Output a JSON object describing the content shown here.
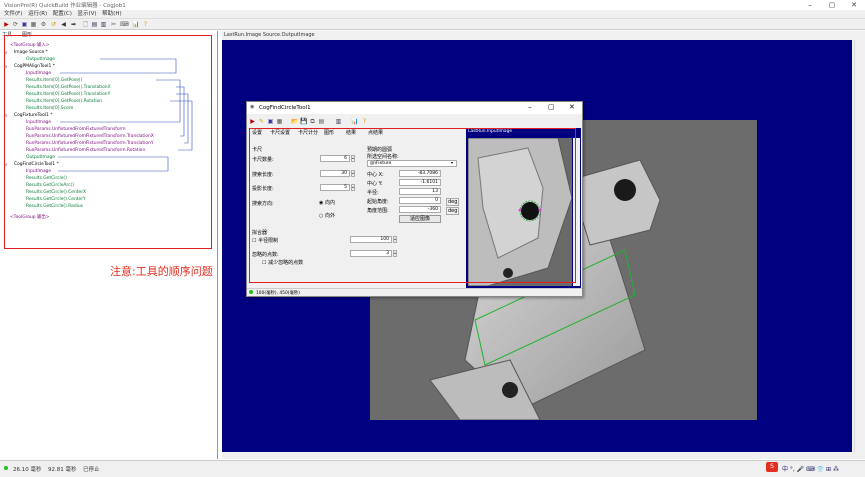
{
  "window": {
    "title": "VisionPro(R) QuickBuild 作业编辑器 - CogJob1"
  },
  "menu": [
    "文件(F)",
    "运行(R)",
    "配置(C)",
    "显示(V)",
    "帮助(H)"
  ],
  "left_tabs": [
    "工具",
    "图形"
  ],
  "tree": [
    {
      "text": "<ToolGroup 输入>",
      "c": "purple"
    },
    {
      "text": "Image Source *",
      "c": "dk"
    },
    {
      "text": "OutputImage",
      "c": "green"
    },
    {
      "text": "CogPMAlignTool1 *",
      "c": "dk"
    },
    {
      "text": "InputImage",
      "c": "purple"
    },
    {
      "text": "Results.Item[0].GetPose()",
      "c": "green"
    },
    {
      "text": "Results.Item[0].GetPose().TranslationX",
      "c": "green"
    },
    {
      "text": "Results.Item[0].GetPose().TranslationY",
      "c": "green"
    },
    {
      "text": "Results.Item[0].GetPose().Rotation",
      "c": "green"
    },
    {
      "text": "Results.Item[0].Score",
      "c": "green"
    },
    {
      "text": "CogFixtureTool1 *",
      "c": "dk"
    },
    {
      "text": "InputImage",
      "c": "purple"
    },
    {
      "text": "RunParams.UnfixturedFromFixturedTransform",
      "c": "purple"
    },
    {
      "text": "RunParams.UnfixturedFromFixturedTransform.TranslationX",
      "c": "purple"
    },
    {
      "text": "RunParams.UnfixturedFromFixturedTransform.TranslationY",
      "c": "purple"
    },
    {
      "text": "RunParams.UnfixturedFromFixturedTransform.Rotation",
      "c": "purple"
    },
    {
      "text": "OutputImage",
      "c": "green"
    },
    {
      "text": "CogFindCircleTool1 *",
      "c": "dk"
    },
    {
      "text": "InputImage",
      "c": "purple"
    },
    {
      "text": "Results.GetCircle()",
      "c": "green"
    },
    {
      "text": "Results.GetCircleArc()",
      "c": "green"
    },
    {
      "text": "Results.GetCircle().CenterX",
      "c": "green"
    },
    {
      "text": "Results.GetCircle().CenterY",
      "c": "green"
    },
    {
      "text": "Results.GetCircle().Radius",
      "c": "green"
    },
    {
      "text": "<ToolGroup 输出>",
      "c": "purple"
    }
  ],
  "note": "注意:工具的顺序问题",
  "right_title": "LastRun.Image Source.OutputImage",
  "dialog": {
    "title": "CogFindCircleTool1",
    "tabs": [
      "设置",
      "卡尺设置",
      "卡尺计分",
      "图形",
      "结果",
      "点结果"
    ],
    "image_label": "LastRun.InputImage",
    "caliper_title": "卡尺",
    "caliper_count_label": "卡尺数量:",
    "caliper_count": "6",
    "search_len_label": "搜索长度:",
    "search_len": "30",
    "proj_len_label": "投影长度:",
    "proj_len": "5",
    "search_dir_label": "搜索方向:",
    "dir_in": "向内",
    "dir_out": "向外",
    "expected_title": "预期的圆弧",
    "space_label": "所选空间名称:",
    "space_value": "@\\Fixture",
    "cx_label": "中心 X:",
    "cx": "-83.7086",
    "cy_label": "中心 Y:",
    "cy": "-1.6101",
    "r_label": "半径:",
    "r": "13",
    "start_label": "起始角度:",
    "start": "0",
    "span_label": "角度范围:",
    "span": "-360",
    "deg": "deg",
    "fit_btn": "适应图像",
    "fitter_title": "拟合器",
    "radius_constraint": "半径限制",
    "radius_value": "100",
    "ignore_label": "忽略的点数:",
    "ignore_value": "3",
    "reduce_label": "减少忽略的点数",
    "status": "100(毫秒), 450(毫秒)"
  },
  "status": {
    "t1": "26.10 毫秒",
    "t2": "92.81 毫秒",
    "t3": "已停止"
  },
  "tray": "中 °, 🎤 ⌨ 👕 ⊞ ⁂",
  "colors": {
    "purple": "#7a0a7a",
    "green": "#0a7a3a",
    "navy": "#000080",
    "red": "#e02020"
  }
}
